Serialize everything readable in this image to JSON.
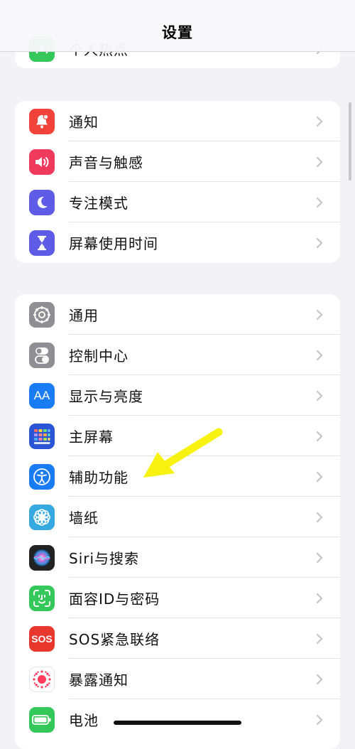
{
  "header": {
    "title": "设置"
  },
  "groups": [
    {
      "items": [
        {
          "label": "个人热点",
          "icon": "hotspot-icon",
          "color": "#34c759"
        }
      ]
    },
    {
      "items": [
        {
          "label": "通知",
          "icon": "bell-icon",
          "color": "#f2433a"
        },
        {
          "label": "声音与触感",
          "icon": "speaker-icon",
          "color": "#ef3a5d"
        },
        {
          "label": "专注模式",
          "icon": "moon-icon",
          "color": "#5e5ce6"
        },
        {
          "label": "屏幕使用时间",
          "icon": "hourglass-icon",
          "color": "#5e5ce6"
        }
      ]
    },
    {
      "items": [
        {
          "label": "通用",
          "icon": "gear-icon",
          "color": "#8e8e93"
        },
        {
          "label": "控制中心",
          "icon": "toggles-icon",
          "color": "#8e8e93"
        },
        {
          "label": "显示与亮度",
          "icon": "display-aa-icon",
          "color": "#1a7cf5"
        },
        {
          "label": "主屏幕",
          "icon": "home-screen-grid-icon",
          "color": "#2a55d6"
        },
        {
          "label": "辅助功能",
          "icon": "accessibility-icon",
          "color": "#1a7cf5"
        },
        {
          "label": "墙纸",
          "icon": "flower-icon",
          "color": "#35a9e0"
        },
        {
          "label": "Siri与搜索",
          "icon": "siri-icon",
          "color": "#222222"
        },
        {
          "label": "面容ID与密码",
          "icon": "face-id-icon",
          "color": "#34c759"
        },
        {
          "label": "SOS紧急联络",
          "icon": "sos-icon",
          "color": "#e8372c"
        },
        {
          "label": "暴露通知",
          "icon": "exposure-icon",
          "color": "#ffffff"
        },
        {
          "label": "电池",
          "icon": "battery-icon",
          "color": "#34c759"
        }
      ]
    }
  ],
  "icons": {
    "sos_text": "SOS",
    "aa_text": "AA"
  },
  "annotation": {
    "arrow_color": "#f7f20f"
  }
}
